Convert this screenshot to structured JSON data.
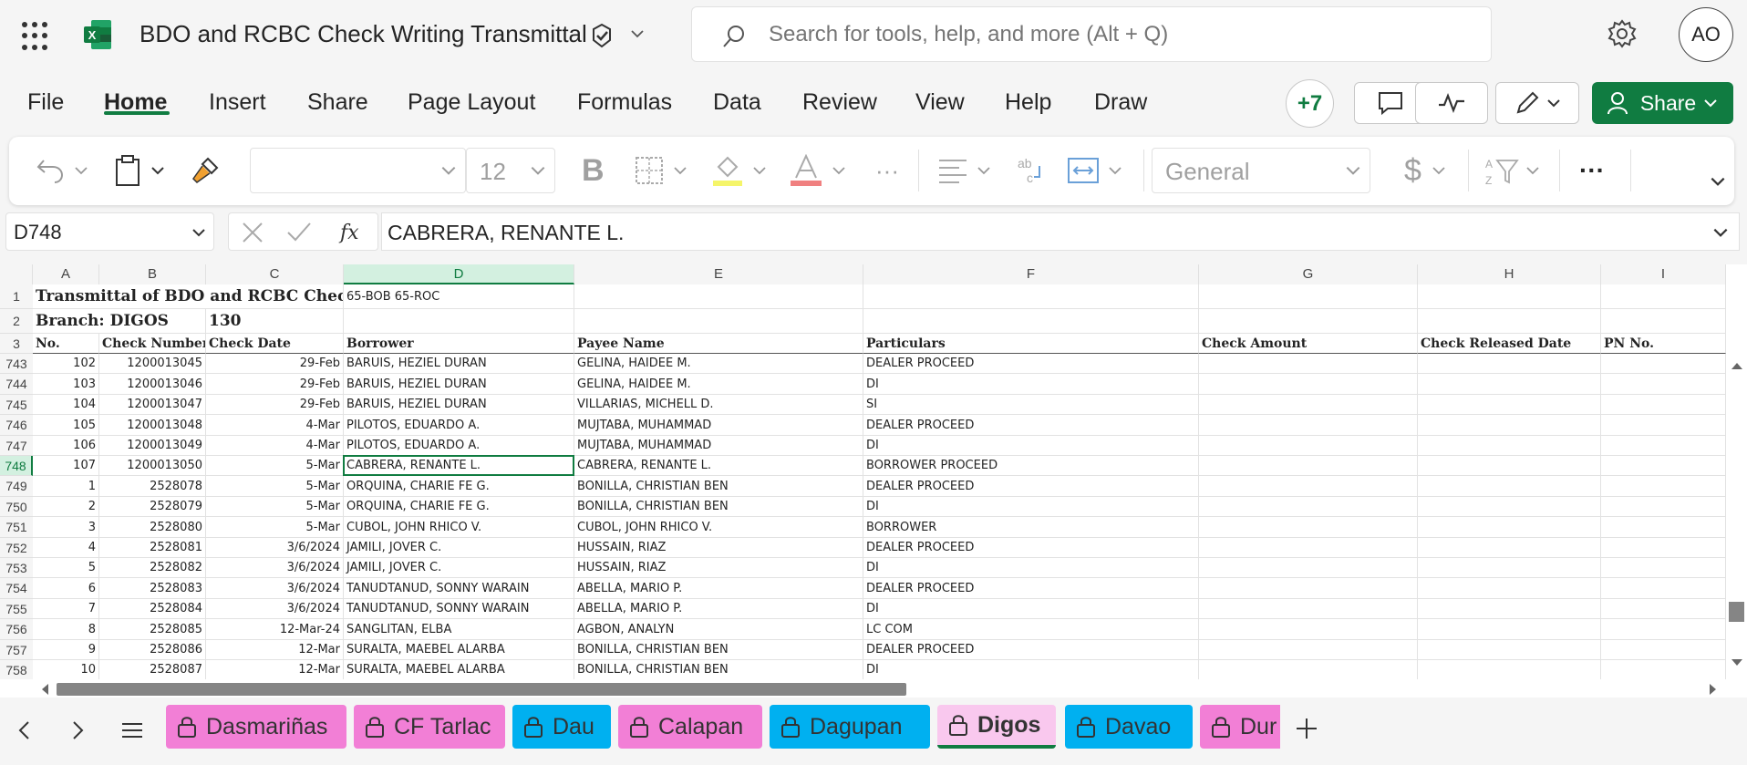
{
  "app": {
    "title": "BDO and RCBC Check Writing Transmittal",
    "search_placeholder": "Search for tools, help, and more (Alt + Q)",
    "avatar_initials": "AO",
    "accent_color": "#107c41"
  },
  "menu": {
    "items": [
      "File",
      "Home",
      "Insert",
      "Share",
      "Page Layout",
      "Formulas",
      "Data",
      "Review",
      "View",
      "Help",
      "Draw"
    ],
    "active": "Home",
    "collab_count": "+7",
    "share_label": "Share"
  },
  "ribbon": {
    "font_size": "12",
    "number_format": "General"
  },
  "formula_bar": {
    "name_box": "D748",
    "formula": "CABRERA, RENANTE L."
  },
  "sheet": {
    "columns": [
      "A",
      "B",
      "C",
      "D",
      "E",
      "F",
      "G",
      "H",
      "I"
    ],
    "selected_column": "D",
    "selected_row": "748",
    "row1": {
      "a": "Transmittal of BDO and RCBC Check",
      "d": "65-BOB 65-ROC"
    },
    "row2": {
      "a": "Branch: DIGOS",
      "c": "130"
    },
    "headers": [
      "No.",
      "Check Number",
      "Check Date",
      "Borrower",
      "Payee Name",
      "Particulars",
      "Check Amount",
      "Check Released Date",
      "PN No."
    ],
    "rows": [
      {
        "row": "743",
        "no": "102",
        "check": "1200013045",
        "date": "29-Feb",
        "borrower": "BARUIS, HEZIEL DURAN",
        "payee": "GELINA, HAIDEE M.",
        "particulars": "DEALER PROCEED"
      },
      {
        "row": "744",
        "no": "103",
        "check": "1200013046",
        "date": "29-Feb",
        "borrower": "BARUIS, HEZIEL DURAN",
        "payee": "GELINA, HAIDEE M.",
        "particulars": "DI"
      },
      {
        "row": "745",
        "no": "104",
        "check": "1200013047",
        "date": "29-Feb",
        "borrower": "BARUIS, HEZIEL DURAN",
        "payee": "VILLARIAS, MICHELL D.",
        "particulars": "SI"
      },
      {
        "row": "746",
        "no": "105",
        "check": "1200013048",
        "date": "4-Mar",
        "borrower": "PILOTOS,  EDUARDO A.",
        "payee": "MUJTABA, MUHAMMAD",
        "particulars": "DEALER PROCEED"
      },
      {
        "row": "747",
        "no": "106",
        "check": "1200013049",
        "date": "4-Mar",
        "borrower": "PILOTOS, EDUARDO A.",
        "payee": "MUJTABA, MUHAMMAD",
        "particulars": "DI"
      },
      {
        "row": "748",
        "no": "107",
        "check": "1200013050",
        "date": "5-Mar",
        "borrower": "CABRERA, RENANTE L.",
        "payee": "CABRERA, RENANTE L.",
        "particulars": "BORROWER PROCEED"
      },
      {
        "row": "749",
        "no": "1",
        "check": "2528078",
        "date": "5-Mar",
        "borrower": "ORQUINA, CHARIE FE G.",
        "payee": "BONILLA, CHRISTIAN BEN",
        "particulars": "DEALER PROCEED"
      },
      {
        "row": "750",
        "no": "2",
        "check": "2528079",
        "date": "5-Mar",
        "borrower": "ORQUINA, CHARIE FE G.",
        "payee": "BONILLA, CHRISTIAN BEN",
        "particulars": "DI"
      },
      {
        "row": "751",
        "no": "3",
        "check": "2528080",
        "date": "5-Mar",
        "borrower": "CUBOL, JOHN RHICO V.",
        "payee": "CUBOL, JOHN RHICO V.",
        "particulars": "BORROWER"
      },
      {
        "row": "752",
        "no": "4",
        "check": "2528081",
        "date": "3/6/2024",
        "borrower": "JAMILI, JOVER C.",
        "payee": "HUSSAIN, RIAZ",
        "particulars": "DEALER PROCEED"
      },
      {
        "row": "753",
        "no": "5",
        "check": "2528082",
        "date": "3/6/2024",
        "borrower": "JAMILI, JOVER C.",
        "payee": "HUSSAIN, RIAZ",
        "particulars": "DI"
      },
      {
        "row": "754",
        "no": "6",
        "check": "2528083",
        "date": "3/6/2024",
        "borrower": "TANUDTANUD, SONNY WARAIN",
        "payee": "ABELLA, MARIO P.",
        "particulars": "DEALER PROCEED"
      },
      {
        "row": "755",
        "no": "7",
        "check": "2528084",
        "date": "3/6/2024",
        "borrower": "TANUDTANUD, SONNY WARAIN",
        "payee": "ABELLA, MARIO P.",
        "particulars": "DI"
      },
      {
        "row": "756",
        "no": "8",
        "check": "2528085",
        "date": "12-Mar-24",
        "borrower": "SANGLITAN, ELBA",
        "payee": "AGBON, ANALYN",
        "particulars": "LC COM"
      },
      {
        "row": "757",
        "no": "9",
        "check": "2528086",
        "date": "12-Mar",
        "borrower": "SURALTA, MAEBEL ALARBA",
        "payee": "BONILLA, CHRISTIAN BEN",
        "particulars": "DEALER PROCEED"
      },
      {
        "row": "758",
        "no": "10",
        "check": "2528087",
        "date": "12-Mar",
        "borrower": "SURALTA, MAEBEL ALARBA",
        "payee": "BONILLA, CHRISTIAN BEN",
        "particulars": "DI"
      }
    ]
  },
  "sheet_tabs": [
    {
      "label": "Dasmariñas",
      "color": "#f27fd6"
    },
    {
      "label": "CF Tarlac",
      "color": "#f27fd6"
    },
    {
      "label": "Dau",
      "color": "#00b0f0"
    },
    {
      "label": "Calapan",
      "color": "#f27fd6"
    },
    {
      "label": "Dagupan",
      "color": "#00b0f0"
    },
    {
      "label": "Digos",
      "color": "#f9c8ee",
      "active": true
    },
    {
      "label": "Davao",
      "color": "#00b0f0"
    },
    {
      "label": "Dur",
      "color": "#f27fd6"
    }
  ]
}
